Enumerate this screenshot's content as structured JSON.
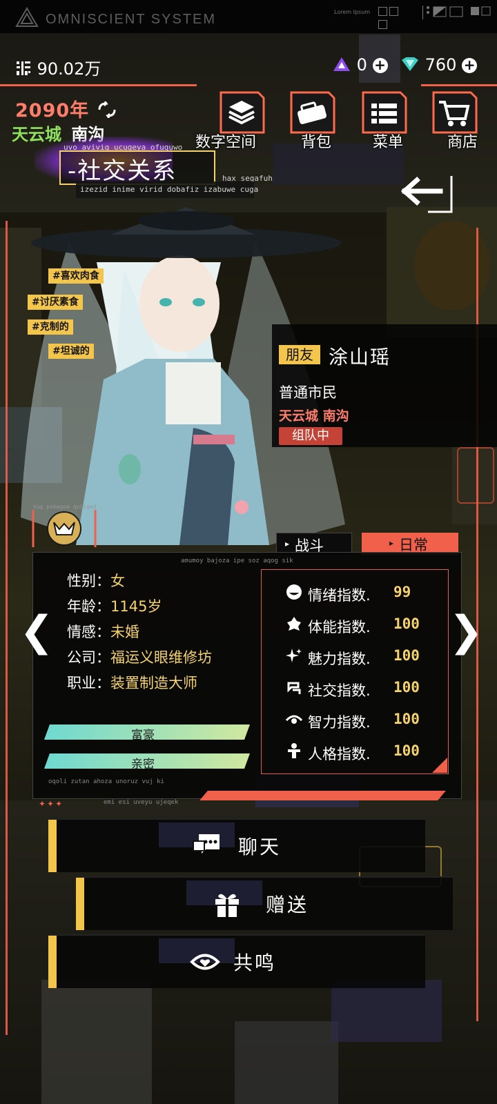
{
  "system": {
    "title": "OMNISCIENT SYSTEM",
    "lorem": "Lorem Ipsum"
  },
  "resources": {
    "coins": "90.02万",
    "gems": "0",
    "diamonds": "760"
  },
  "world": {
    "year": "2090年",
    "city": "天云城",
    "district": "南沟"
  },
  "nav": [
    {
      "label": "数字空间",
      "icon": "layers-icon"
    },
    {
      "label": "背包",
      "icon": "backpack-icon"
    },
    {
      "label": "菜单",
      "icon": "menu-icon"
    },
    {
      "label": "商店",
      "icon": "cart-icon"
    }
  ],
  "page": {
    "title": "-社交关系",
    "caption_top": "uvo avivig ucugeya ofuguwo",
    "caption_right": "hax segafuh",
    "caption_bottom": "izezid inime virid dobafiz izabuwe cuga"
  },
  "tags": [
    "#喜欢肉食",
    "#讨厌素食",
    "#克制的",
    "#坦诚的"
  ],
  "portrait_caption": "kug pokegoe qoiiged",
  "character": {
    "relation": "朋友",
    "name": "涂山瑶",
    "occupation_type": "普通市民",
    "city": "天云城",
    "district": "南沟",
    "status": "组队中"
  },
  "tabs": {
    "battle": "战斗",
    "daily": "日常"
  },
  "panel": {
    "caption_top": "amumoy bajoza ipe soz aqog sik",
    "caption_bottom_1": "oqoli zutan ahoza unoruz vuj ki",
    "caption_bottom_2": "emi esi uveyu ujeqek",
    "info": [
      {
        "key": "性别：",
        "value": "女"
      },
      {
        "key": "年龄：",
        "value": "1145岁"
      },
      {
        "key": "情感：",
        "value": "未婚"
      },
      {
        "key": "公司：",
        "value": "福运义眼维修坊"
      },
      {
        "key": "职业：",
        "value": "装置制造大师"
      }
    ],
    "bars": [
      {
        "label": "富豪",
        "fill_percent": 100
      },
      {
        "label": "亲密",
        "fill_percent": 100
      }
    ],
    "stats": [
      {
        "label": "情绪指数.",
        "value": "99",
        "icon": "mood-icon"
      },
      {
        "label": "体能指数.",
        "value": "100",
        "icon": "stamina-icon"
      },
      {
        "label": "魅力指数.",
        "value": "100",
        "icon": "sparkle-icon"
      },
      {
        "label": "社交指数.",
        "value": "100",
        "icon": "social-icon"
      },
      {
        "label": "智力指数.",
        "value": "100",
        "icon": "eye-icon"
      },
      {
        "label": "人格指数.",
        "value": "100",
        "icon": "person-icon"
      }
    ]
  },
  "actions": [
    {
      "label": "聊天",
      "icon": "chat-icon"
    },
    {
      "label": "赠送",
      "icon": "gift-icon"
    },
    {
      "label": "共鸣",
      "icon": "resonance-icon"
    }
  ],
  "colors": {
    "accent": "#f0604a",
    "gold": "#f5d36a",
    "tag": "#f3c54a",
    "green": "#8ee25d",
    "orange": "#ff7e6b"
  }
}
